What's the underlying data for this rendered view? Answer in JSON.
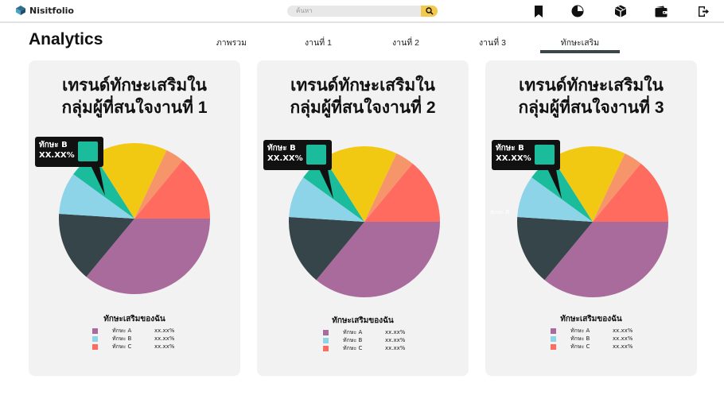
{
  "app": {
    "brand": "Nisitfolio"
  },
  "search": {
    "placeholder": "ค้นหา"
  },
  "page": {
    "title": "Analytics"
  },
  "tabs": [
    {
      "label": "ภาพรวม"
    },
    {
      "label": "งานที่ 1"
    },
    {
      "label": "งานที่ 2"
    },
    {
      "label": "งานที่ 3"
    },
    {
      "label": "ทักษะเสริม",
      "active": true
    }
  ],
  "nav_icons": [
    "bookmark-icon",
    "pie-chart-icon",
    "cube-icon",
    "wallet-icon",
    "logout-icon"
  ],
  "colors": {
    "accent": "#f2c94c",
    "tab_underline": "#3b464b",
    "card_bg": "#f2f2f2"
  },
  "cards": [
    {
      "title_line1": "เทรนด์ทักษะเสริมใน",
      "title_line2": "กลุ่มผู้ที่สนใจงานที่ 1",
      "tooltip": {
        "label": "ทักษะ B",
        "value": "XX.XX%"
      },
      "legend_title": "ทักษะเสริมของฉัน",
      "legend": [
        {
          "name": "ทักษะ A",
          "value": "xx.xx%"
        },
        {
          "name": "ทักษะ B",
          "value": "xx.xx%"
        },
        {
          "name": "ทักษะ C",
          "value": "xx.xx%"
        }
      ]
    },
    {
      "title_line1": "เทรนด์ทักษะเสริมใน",
      "title_line2": "กลุ่มผู้ที่สนใจงานที่ 2",
      "tooltip": {
        "label": "ทักษะ B",
        "value": "XX.XX%"
      },
      "legend_title": "ทักษะเสริมของฉัน",
      "legend": [
        {
          "name": "ทักษะ A",
          "value": "xx.xx%"
        },
        {
          "name": "ทักษะ B",
          "value": "xx.xx%"
        },
        {
          "name": "ทักษะ C",
          "value": "xx.xx%"
        }
      ]
    },
    {
      "title_line1": "เทรนด์ทักษะเสริมใน",
      "title_line2": "กลุ่มผู้ที่สนใจงานที่ 3",
      "tooltip": {
        "label": "ทักษะ B",
        "value": "XX.XX%"
      },
      "ghost_label": "ทักษะ B",
      "legend_title": "ทักษะเสริมของฉัน",
      "legend": [
        {
          "name": "ทักษะ A",
          "value": "xx.xx%"
        },
        {
          "name": "ทักษะ B",
          "value": "xx.xx%"
        },
        {
          "name": "ทักษะ C",
          "value": "xx.xx%"
        }
      ]
    }
  ],
  "chart_data": [
    {
      "type": "pie",
      "slices": [
        {
          "value": 36,
          "color": "#a86b9c"
        },
        {
          "value": 15,
          "color": "#36454a"
        },
        {
          "value": 9,
          "color": "#8dd4e8"
        },
        {
          "value": 6,
          "color": "#1abc9c"
        },
        {
          "value": 16,
          "color": "#f2c912"
        },
        {
          "value": 4,
          "color": "#f7956a"
        },
        {
          "value": 14,
          "color": "#ff6b5f"
        }
      ]
    },
    {
      "type": "pie",
      "slices": [
        {
          "value": 36,
          "color": "#a86b9c"
        },
        {
          "value": 15,
          "color": "#36454a"
        },
        {
          "value": 9,
          "color": "#8dd4e8"
        },
        {
          "value": 6,
          "color": "#1abc9c"
        },
        {
          "value": 16,
          "color": "#f2c912"
        },
        {
          "value": 4,
          "color": "#f7956a"
        },
        {
          "value": 14,
          "color": "#ff6b5f"
        }
      ]
    },
    {
      "type": "pie",
      "slices": [
        {
          "value": 36,
          "color": "#a86b9c"
        },
        {
          "value": 15,
          "color": "#36454a"
        },
        {
          "value": 9,
          "color": "#8dd4e8"
        },
        {
          "value": 6,
          "color": "#1abc9c"
        },
        {
          "value": 16,
          "color": "#f2c912"
        },
        {
          "value": 4,
          "color": "#f7956a"
        },
        {
          "value": 14,
          "color": "#ff6b5f"
        }
      ]
    }
  ],
  "legend_colors": [
    "#a86b9c",
    "#8dd4e8",
    "#ff6b5f"
  ]
}
